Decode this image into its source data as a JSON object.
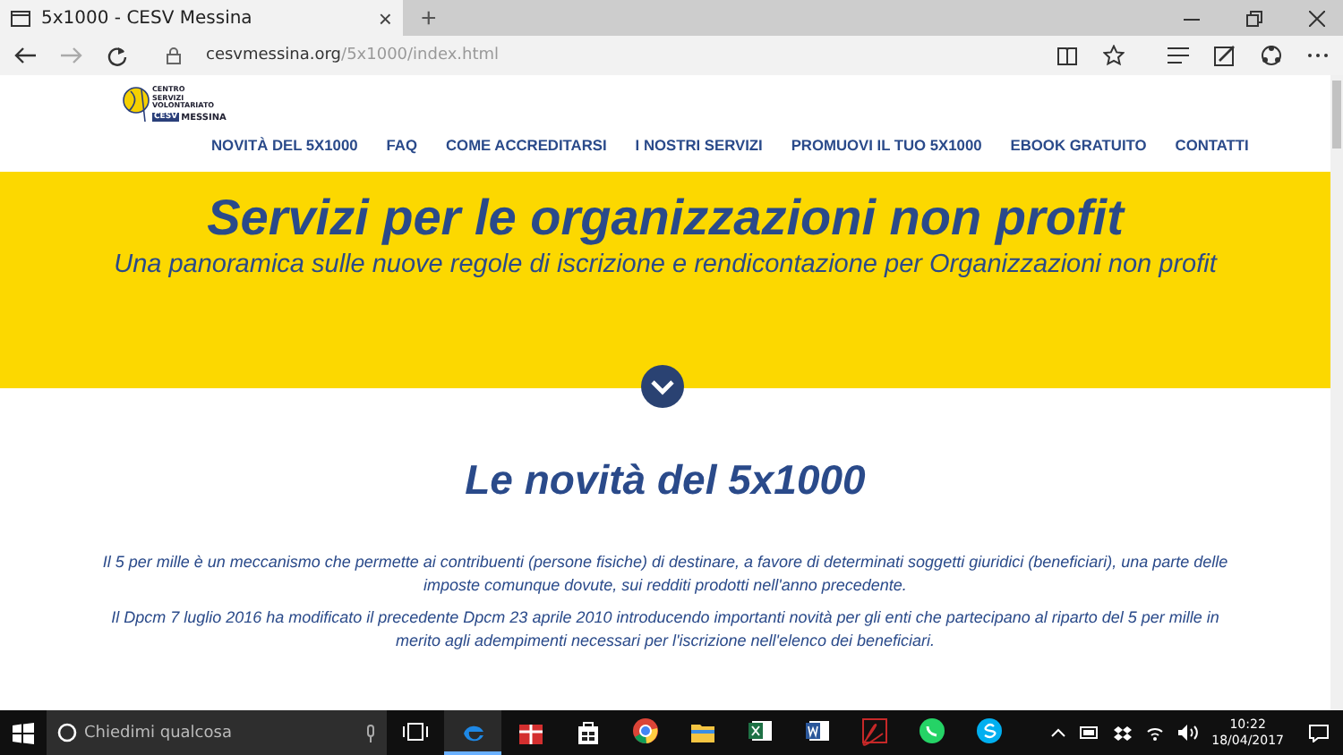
{
  "browser": {
    "tab_title": "5x1000 - CESV Messina",
    "tab_close": "×",
    "new_tab": "+",
    "url_host": "cesvmessina.org",
    "url_path": "/5x1000/index.html"
  },
  "site": {
    "logo_lines": [
      "CENTRO",
      "SERVIZI",
      "VOLONTARIATO"
    ],
    "logo_badge": "CESV",
    "logo_city": "MESSINA",
    "nav": [
      {
        "label": "NOVITÀ DEL 5X1000",
        "selected": false
      },
      {
        "label": "FAQ",
        "selected": false
      },
      {
        "label": "COME ACCREDITARSI",
        "selected": false
      },
      {
        "label": "I NOSTRI SERVIZI",
        "selected": false
      },
      {
        "label": "PROMUOVI IL TUO 5X1000",
        "selected": false
      },
      {
        "label": "EBOOK GRATUITO",
        "selected": false
      },
      {
        "label": "CONTATTI",
        "selected": false
      }
    ],
    "hero": {
      "title": "Servizi per le organizzazioni non profit",
      "subtitle": "Una panoramica sulle nuove regole di iscrizione e rendicontazione per Organizzazioni non profit"
    },
    "section": {
      "title": "Le novità del 5x1000",
      "paragraphs": [
        "Il 5 per mille è un meccanismo che permette ai contribuenti (persone fisiche) di destinare, a favore di determinati soggetti giuridici (beneficiari), una parte delle imposte comunque dovute, sui redditi prodotti nell'anno precedente.",
        "Il Dpcm 7 luglio 2016 ha modificato il precedente Dpcm 23 aprile 2010 introducendo importanti novità per gli enti che partecipano al riparto del 5 per mille in merito agli adempimenti necessari per l'iscrizione nell'elenco dei beneficiari."
      ]
    }
  },
  "taskbar": {
    "search_placeholder": "Chiedimi qualcosa",
    "apps": [
      {
        "kind": "edge",
        "selected": true
      },
      {
        "kind": "gift",
        "selected": false
      },
      {
        "kind": "store",
        "selected": false
      },
      {
        "kind": "chrome",
        "selected": false
      },
      {
        "kind": "explorer",
        "selected": false
      },
      {
        "kind": "excel",
        "selected": false
      },
      {
        "kind": "word",
        "selected": false
      },
      {
        "kind": "acrobat",
        "selected": false
      },
      {
        "kind": "whatsapp",
        "selected": false
      },
      {
        "kind": "skype",
        "selected": false
      }
    ],
    "time": "10:22",
    "date": "18/04/2017"
  }
}
